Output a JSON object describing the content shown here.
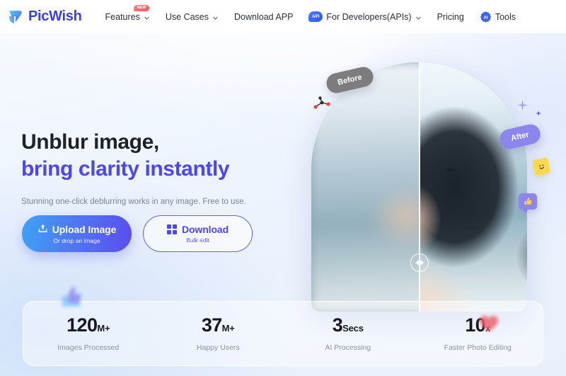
{
  "brand": {
    "name": "PicWish",
    "logo_icon": "picwish-bird-logo",
    "accent_color": "#3a3ef0"
  },
  "nav": {
    "items": [
      {
        "label": "Features",
        "icon": "chevron-down-icon",
        "has_caret": true,
        "badge": "NEW"
      },
      {
        "label": "Use Cases",
        "icon": "chevron-down-icon",
        "has_caret": true
      },
      {
        "label": "Download APP",
        "has_caret": false
      },
      {
        "label": "For Developers(APIs)",
        "icon": "api-icon",
        "icon_text": "API",
        "has_caret": true
      },
      {
        "label": "Pricing",
        "has_caret": false
      },
      {
        "label": "Tools",
        "icon": "ai-gear-icon",
        "icon_text": "AI",
        "has_caret": false
      }
    ]
  },
  "hero": {
    "title_line1": "Unblur image,",
    "title_line2": "bring clarity instantly",
    "subtitle": "Stunning one-click deblurring works in any image. Free to use.",
    "title_accent_color": "#4b46ef"
  },
  "cta": {
    "upload": {
      "label": "Upload Image",
      "sublabel": "Or drop an image",
      "icon": "upload-icon"
    },
    "download": {
      "label": "Download",
      "sublabel": "Bulk edit",
      "icon": "windows-icon"
    }
  },
  "comparison": {
    "before_label": "Before",
    "after_label": "After",
    "before_color": "#7d7d7d",
    "after_color": "#8b86ee",
    "slider_icon": "left-right-arrows-icon",
    "slider_position_percent": 50,
    "image_alt": "Smiling woman with dark hair, blurred on left half and sharp on right half"
  },
  "stats": {
    "items": [
      {
        "number": "120",
        "unit": "M+",
        "label": "Images Processed"
      },
      {
        "number": "37",
        "unit": "M+",
        "label": "Happy Users"
      },
      {
        "number": "3",
        "unit": "Secs",
        "label": "AI Processing"
      },
      {
        "number": "10",
        "unit": "x",
        "label": "Faster Photo Editing"
      }
    ]
  },
  "decorations": [
    {
      "name": "molecule-icon"
    },
    {
      "name": "sparkle-star-icon"
    },
    {
      "name": "small-star-icon"
    },
    {
      "name": "smiley-bubble-icon",
      "glyph": "☺"
    },
    {
      "name": "thumbs-up-bubble-icon"
    },
    {
      "name": "blurred-thumbs-up-icon"
    },
    {
      "name": "blurred-heart-icon"
    }
  ]
}
